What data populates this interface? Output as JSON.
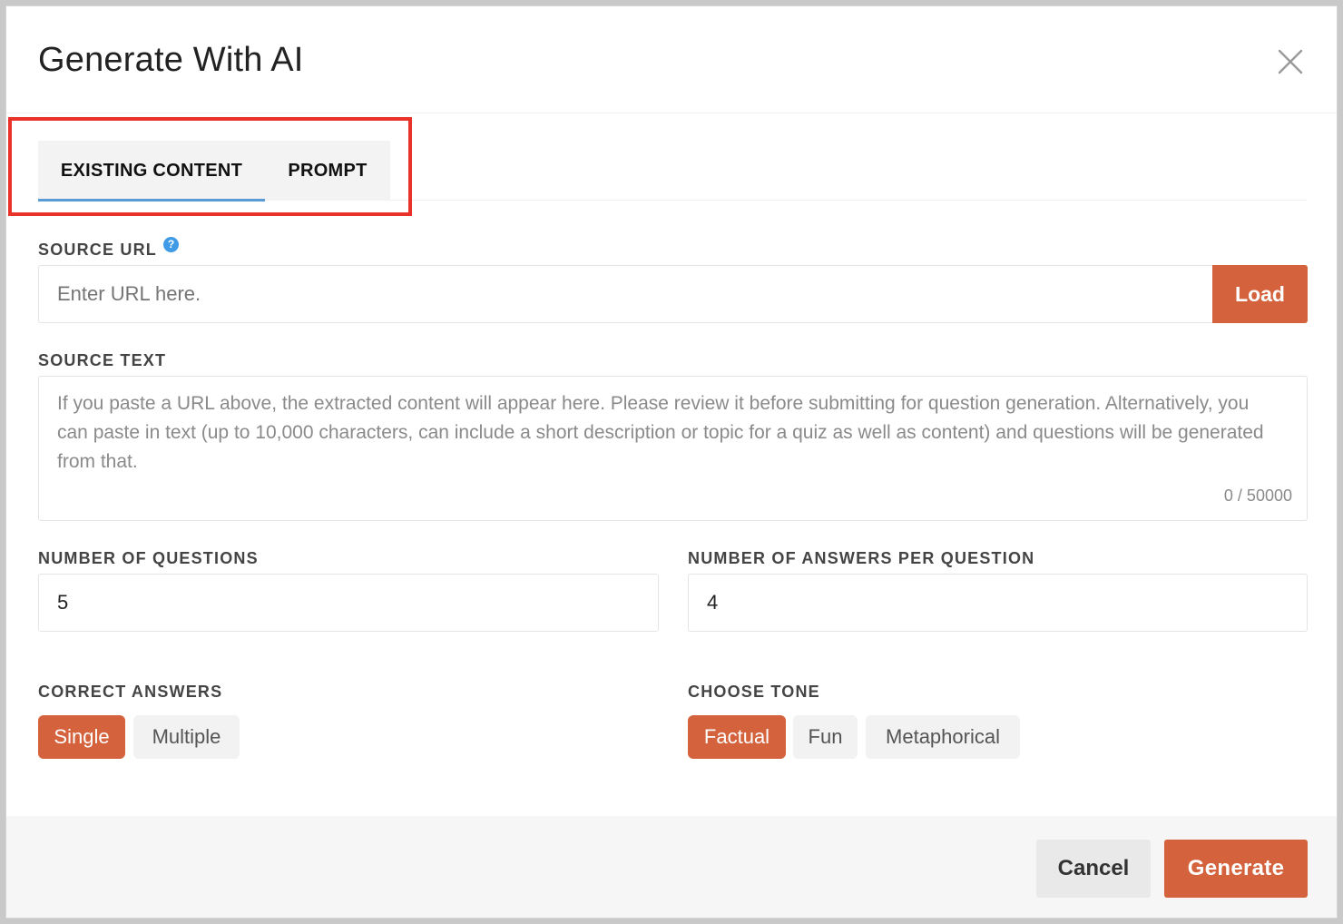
{
  "modal": {
    "title": "Generate With AI",
    "close_icon": "close-icon"
  },
  "tabs": [
    {
      "label": "EXISTING CONTENT",
      "active": true
    },
    {
      "label": "PROMPT",
      "active": false
    }
  ],
  "source_url": {
    "label": "SOURCE URL",
    "help_icon": "help-icon",
    "help_glyph": "?",
    "placeholder": "Enter URL here.",
    "value": "",
    "load_button": "Load"
  },
  "source_text": {
    "label": "SOURCE TEXT",
    "placeholder": "If you paste a URL above, the extracted content will appear here. Please review it before submitting for question generation. Alternatively, you can paste in text (up to 10,000 characters, can include a short description or topic for a quiz as well as content) and questions will be generated from that.",
    "char_count": "0 / 50000"
  },
  "number_of_questions": {
    "label": "NUMBER OF QUESTIONS",
    "value": "5"
  },
  "answers_per_question": {
    "label": "NUMBER OF ANSWERS PER QUESTION",
    "value": "4"
  },
  "correct_answers": {
    "label": "CORRECT ANSWERS",
    "options": [
      {
        "label": "Single",
        "selected": true
      },
      {
        "label": "Multiple",
        "selected": false
      }
    ]
  },
  "tone": {
    "label": "CHOOSE TONE",
    "options": [
      {
        "label": "Factual",
        "selected": true
      },
      {
        "label": "Fun",
        "selected": false
      },
      {
        "label": "Metaphorical",
        "selected": false
      }
    ]
  },
  "footer": {
    "cancel": "Cancel",
    "generate": "Generate"
  },
  "colors": {
    "accent": "#d4623d",
    "tab_underline": "#5b9bd5",
    "highlight": "#e8322a"
  }
}
